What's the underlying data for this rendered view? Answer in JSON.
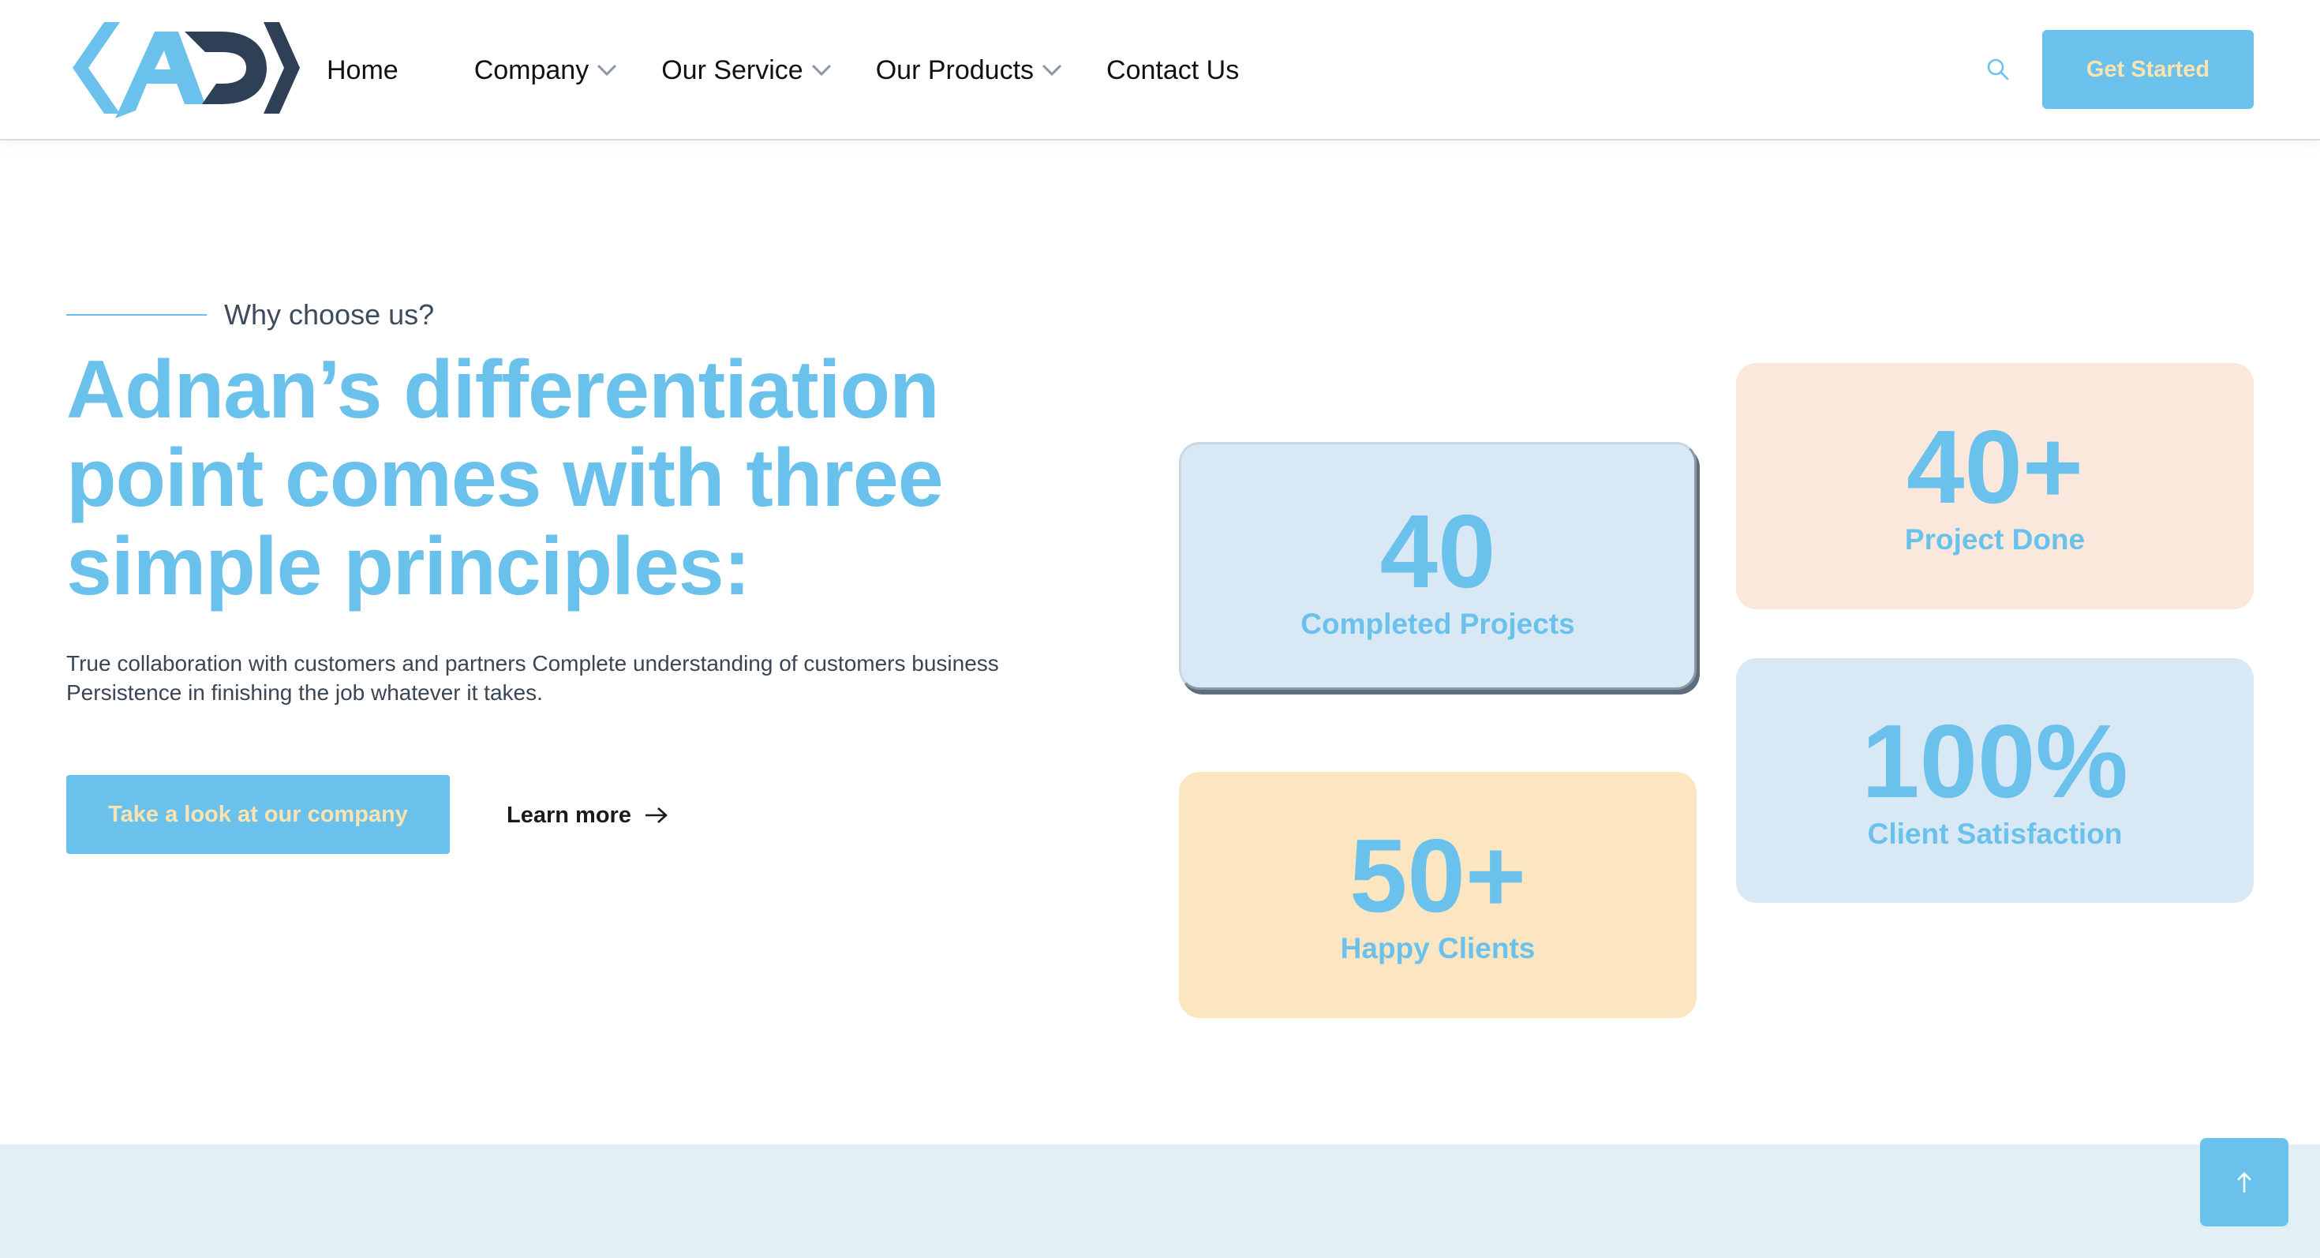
{
  "brand": {
    "logo_icon": "adn-logo-icon",
    "colors": {
      "accent": "#6ac2ec",
      "dark": "#2e3f56",
      "button_text": "#fce3b0"
    }
  },
  "nav": {
    "items": [
      {
        "label": "Home",
        "has_dropdown": false
      },
      {
        "label": "Company",
        "has_dropdown": true
      },
      {
        "label": "Our Service",
        "has_dropdown": true
      },
      {
        "label": "Our Products",
        "has_dropdown": true
      },
      {
        "label": "Contact Us",
        "has_dropdown": false
      }
    ],
    "search_icon": "search-icon",
    "cta_label": "Get Started"
  },
  "hero": {
    "eyebrow": "Why choose us?",
    "headline": "Adnan’s differentiation point comes with three simple principles:",
    "body_line1": "True collaboration with customers and partners Complete understanding of customers business",
    "body_line2": "Persistence in finishing the job whatever it takes.",
    "primary_button": "Take a look at our company",
    "secondary_link": "Learn more"
  },
  "stats": [
    {
      "value": "40",
      "label": "Completed Projects",
      "bg": "#d8e9f5"
    },
    {
      "value": "50+",
      "label": "Happy Clients",
      "bg": "#fbe6c1"
    },
    {
      "value": "40+",
      "label": "Project Done",
      "bg": "#fbe8dc"
    },
    {
      "value": "100%",
      "label": "Client Satisfaction",
      "bg": "#d8e9f5"
    }
  ],
  "scroll_top_icon": "arrow-up-icon"
}
